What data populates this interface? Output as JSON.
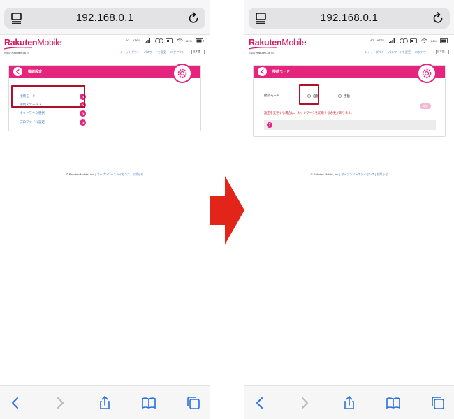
{
  "browser": {
    "url": "192.168.0.1"
  },
  "router": {
    "brand_bold": "Rakuten",
    "brand_light": "Mobile",
    "ssid": "SSID Rakuten-5679",
    "status": {
      "network": "4G",
      "carrier": "KDDI",
      "battery": "84%"
    },
    "links": {
      "shutdown": "シャットダウン",
      "change_password": "パスワードを変更",
      "logout": "ログアウト"
    },
    "language": "日本語"
  },
  "left_panel": {
    "title": "接続設定",
    "menu": [
      {
        "label": "接続モード"
      },
      {
        "label": "接続ステータス"
      },
      {
        "label": "ネットワーク選択"
      },
      {
        "label": "プロファイル設定"
      }
    ]
  },
  "right_panel": {
    "title": "接続モード",
    "field_label": "接続モード",
    "options": {
      "auto": "自動",
      "manual": "手動"
    },
    "selected": "auto",
    "apply": "適用",
    "notice": "設定を変更する場合は、ネットワークを切断する必要があります。",
    "help": "?"
  },
  "footer": {
    "copyright": "© Rakuten Mobile, Inc.",
    "sep1": "|",
    "oss": "オープンソースライセンス",
    "sep2": "|",
    "notices": "お知らせ"
  },
  "colors": {
    "brand": "#e5247d",
    "highlight": "#b0102c",
    "arrow": "#e32418",
    "link": "#3d78c0"
  }
}
